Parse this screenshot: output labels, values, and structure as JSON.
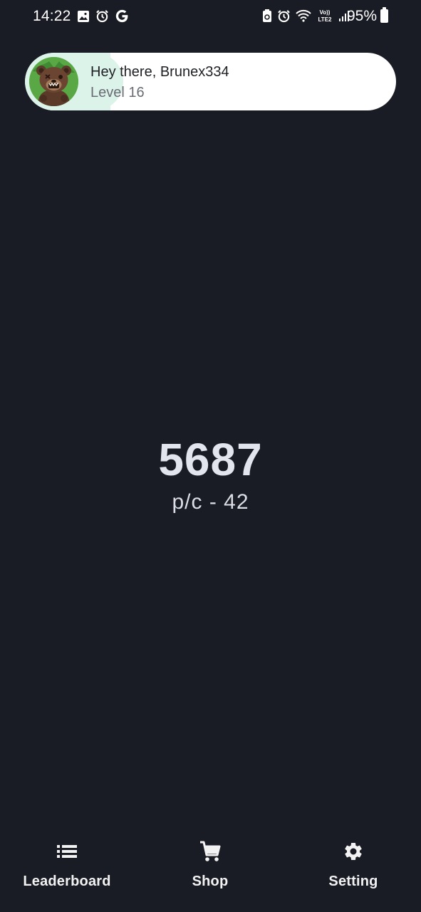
{
  "status_bar": {
    "time": "14:22",
    "battery": "95%",
    "left_icons": [
      "image-icon",
      "alarm-icon",
      "google-icon"
    ],
    "right_icons": [
      "battery-saver-icon",
      "alarm-icon",
      "wifi-icon",
      "lte-icon",
      "signal-icon",
      "battery-icon"
    ]
  },
  "user": {
    "greeting": "Hey there, Brunex334",
    "level": "Level 16",
    "avatar_icon": "bear-avatar-icon"
  },
  "score": {
    "value": "5687",
    "per_click": "p/c - 42"
  },
  "nav": {
    "leaderboard": {
      "label": "Leaderboard",
      "icon": "list-icon"
    },
    "shop": {
      "label": "Shop",
      "icon": "cart-icon"
    },
    "setting": {
      "label": "Setting",
      "icon": "gear-icon"
    }
  },
  "colors": {
    "background": "#1a1c25",
    "card": "#ffffff",
    "avatar_halo": "#dcf3ea",
    "text_primary": "#e2e4ee"
  }
}
